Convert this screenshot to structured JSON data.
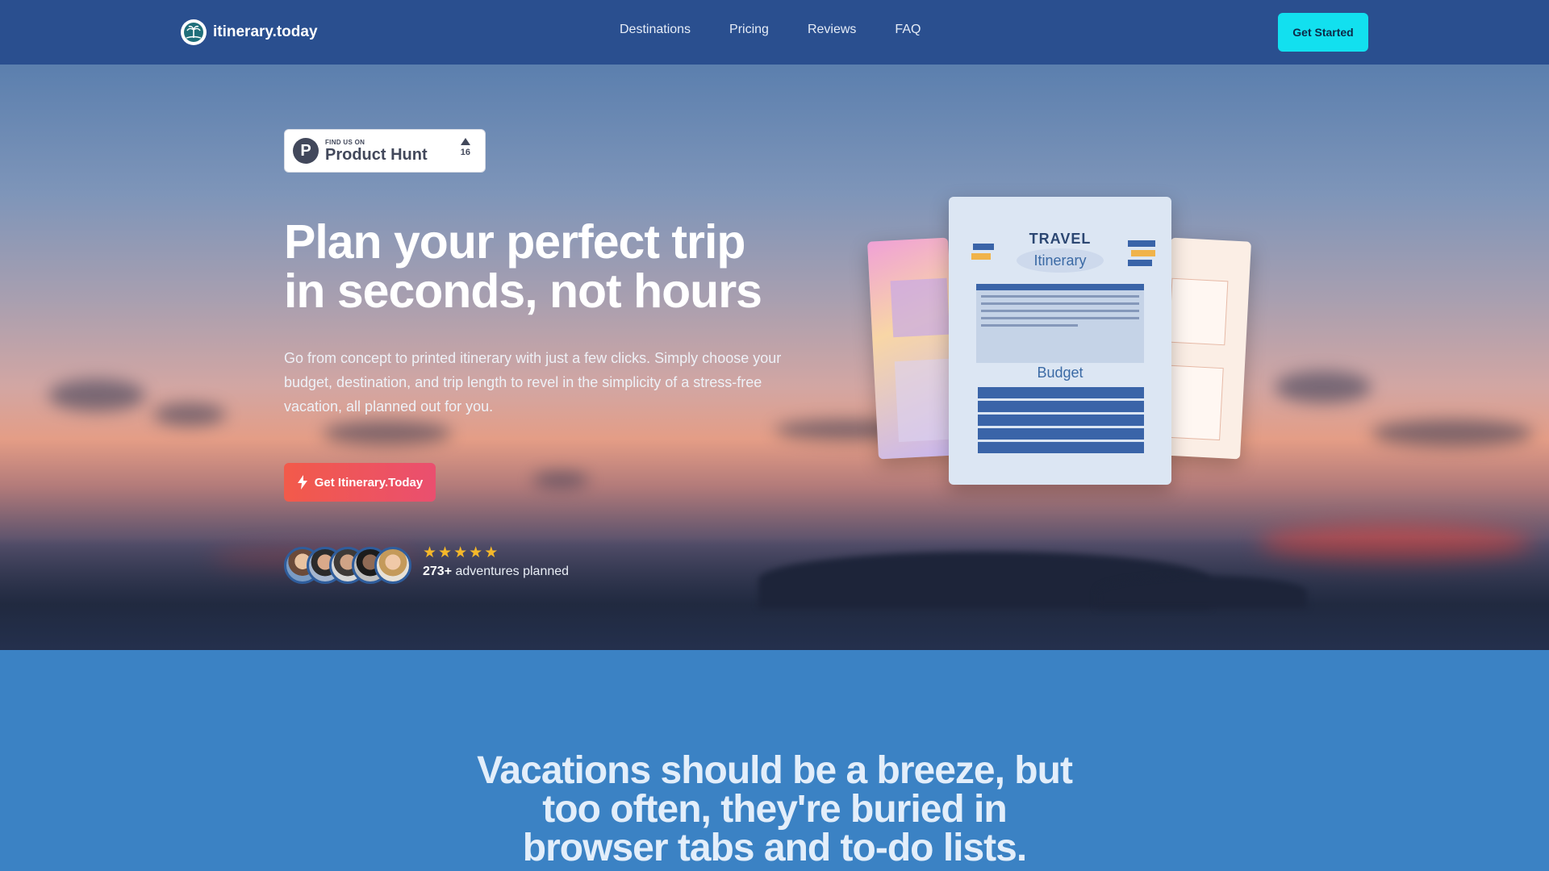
{
  "nav": {
    "brand": "itinerary.today",
    "links": [
      "Destinations",
      "Pricing",
      "Reviews",
      "FAQ"
    ],
    "cta": "Get Started"
  },
  "hero": {
    "badge": {
      "small": "FIND US ON",
      "name": "Product Hunt",
      "count": "16"
    },
    "title_line1": "Plan your perfect trip",
    "title_line2": "in seconds, not hours",
    "subtitle": "Go from concept to printed itinerary with just a few clicks. Simply choose your budget, destination, and trip length to revel in the simplicity of a stress-free vacation, all planned out for you.",
    "cta": "Get Itinerary.Today",
    "rating_stars": 5,
    "planned_count": "273+",
    "planned_label": " adventures planned"
  },
  "preview": {
    "title1": "TRAVEL",
    "title2": "Itinerary",
    "budget": "Budget"
  },
  "section2": {
    "title_line1": "Vacations should be a breeze, but",
    "title_line2": "too often, they're buried in",
    "title_line3": "browser tabs and to-do lists."
  },
  "colors": {
    "nav_bg": "#2a4f8f",
    "cta_top": "#12e0ef",
    "cta_main": "#f25a4a",
    "section_bg": "#3b82c4",
    "stars": "#f5b82a"
  }
}
